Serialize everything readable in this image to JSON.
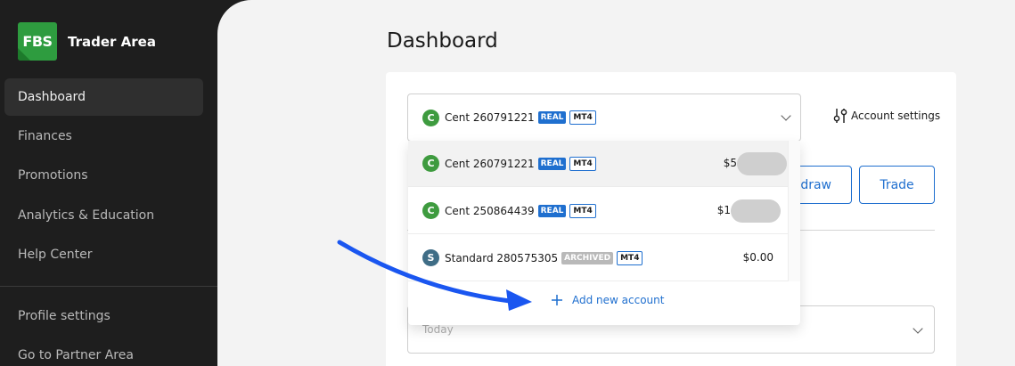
{
  "brand": {
    "logo_text": "FBS",
    "title": "Trader Area"
  },
  "sidebar": {
    "items": [
      {
        "label": "Dashboard",
        "active": true
      },
      {
        "label": "Finances"
      },
      {
        "label": "Promotions"
      },
      {
        "label": "Analytics & Education"
      },
      {
        "label": "Help Center"
      }
    ],
    "bottom_items": [
      {
        "label": "Profile settings"
      },
      {
        "label": "Go to Partner Area"
      }
    ]
  },
  "main": {
    "title": "Dashboard",
    "selected_account": {
      "name": "Cent 260791221",
      "badge_type": "REAL",
      "badge_platform": "MT4",
      "icon": "cent-coin-icon"
    },
    "account_settings_label": "Account settings",
    "withdraw_label_partial": "draw",
    "trade_label": "Trade",
    "date_placeholder": "Today"
  },
  "dropdown": {
    "accounts": [
      {
        "name": "Cent 260791221",
        "badges": [
          "REAL",
          "MT4"
        ],
        "amount": "$5",
        "blurred": true,
        "selected": true,
        "icon": "cent-coin-icon"
      },
      {
        "name": "Cent 250864439",
        "badges": [
          "REAL",
          "MT4"
        ],
        "amount": "$1",
        "blurred": true,
        "selected": false,
        "icon": "cent-coin-icon"
      },
      {
        "name": "Standard 280575305",
        "badges": [
          "ARCHIVED",
          "MT4"
        ],
        "amount": "$0.00",
        "blurred": false,
        "selected": false,
        "icon": "standard-coin-icon"
      }
    ],
    "add_label": "Add new account"
  },
  "colors": {
    "accent": "#1f6fcf",
    "arrow": "#1a56f0",
    "cent_green": "#3e9b3f",
    "brand_green": "#2e9c3f"
  }
}
